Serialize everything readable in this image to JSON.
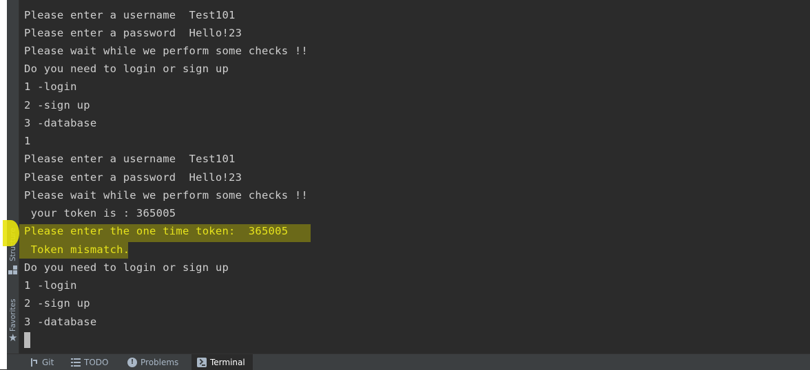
{
  "terminal": {
    "lines": [
      "Please enter a username  Test101",
      "Please enter a password  Hello!23",
      "Please wait while we perform some checks !!",
      "Do you need to login or sign up",
      "1 -login",
      "2 -sign up",
      "3 -database",
      "1",
      "Please enter a username  Test101",
      "Please enter a password  Hello!23",
      "Please wait while we perform some checks !!",
      " your token is : 365005",
      "Please enter the one time token:  365005",
      " Token mismatch.",
      "Do you need to login or sign up",
      "1 -login",
      "2 -sign up",
      "3 -database"
    ]
  },
  "side_panel": {
    "structure_label": "Structure",
    "favorites_label": "Favorites",
    "structure_icon": "structure-icon",
    "favorites_icon": "star-icon"
  },
  "bottom_tabs": {
    "git": "Git",
    "todo": "TODO",
    "problems": "Problems",
    "terminal": "Terminal",
    "active": "Terminal"
  },
  "colors": {
    "terminal_background": "#2b2b2b",
    "terminal_text": "#cfcfcf",
    "highlighted_text": "#e6e31c",
    "highlighter": "#e8e30c"
  }
}
